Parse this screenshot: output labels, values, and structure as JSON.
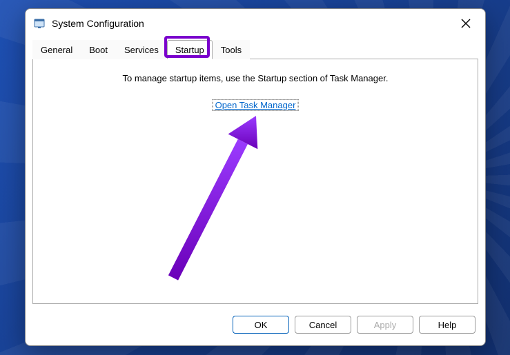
{
  "dialog": {
    "title": "System Configuration",
    "close_label": "Close"
  },
  "tabs": {
    "general": "General",
    "boot": "Boot",
    "services": "Services",
    "startup": "Startup",
    "tools": "Tools",
    "active": "startup"
  },
  "content": {
    "instruction": "To manage startup items, use the Startup section of Task Manager.",
    "link": "Open Task Manager"
  },
  "buttons": {
    "ok": "OK",
    "cancel": "Cancel",
    "apply": "Apply",
    "help": "Help"
  },
  "annotation": {
    "highlight_color": "#7a00cc"
  }
}
